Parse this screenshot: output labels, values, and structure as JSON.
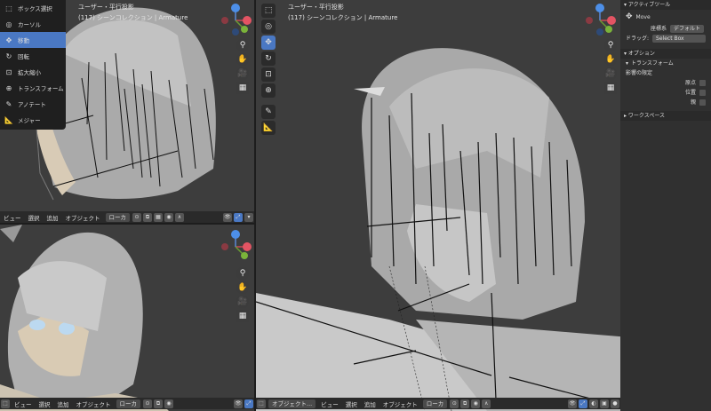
{
  "colors": {
    "viewport_bg": "#3d3d3d",
    "accent": "#4a78c3",
    "panel": "#303030",
    "dark": "#1f1f1f"
  },
  "top_left": {
    "menu": [
      {
        "label": "ボックス選択",
        "icon": "select-box-icon",
        "active": false
      },
      {
        "label": "カーソル",
        "icon": "cursor-icon",
        "active": false
      },
      {
        "label": "移動",
        "icon": "move-icon",
        "active": true
      },
      {
        "label": "回転",
        "icon": "rotate-icon",
        "active": false
      },
      {
        "label": "拡大縮小",
        "icon": "scale-icon",
        "active": false
      },
      {
        "label": "トランスフォーム",
        "icon": "transform-icon",
        "active": false
      },
      {
        "label": "アノテート",
        "icon": "annotate-icon",
        "active": false
      },
      {
        "label": "メジャー",
        "icon": "measure-icon",
        "active": false
      }
    ],
    "header": {
      "view": "ビュー",
      "select": "選択",
      "add": "追加",
      "object": "オブジェクト",
      "orientation": "ローカ"
    }
  },
  "bottom_left": {
    "header": {
      "view": "ビュー",
      "select": "選択",
      "add": "追加",
      "object": "オブジェクト",
      "orientation": "ローカ"
    }
  },
  "main": {
    "hud_line1": "ユーザー・平行投影",
    "hud_line2": "(117) シーンコレクション | Armature",
    "header": {
      "mode": "オブジェクト...",
      "view": "ビュー",
      "select": "選択",
      "add": "追加",
      "object": "オブジェクト",
      "orientation": "ローカ"
    }
  },
  "top_left_hud": {
    "line1": "ユーザー・平行投影",
    "line2": "(117) シーンコレクション | Armature"
  },
  "gizmo": {
    "x": "X",
    "y": "Y",
    "z": "Z"
  },
  "props": {
    "active_tool": "アクティブツール",
    "move": "Move",
    "coord_label": "座標系",
    "coord_value": "デフォルト",
    "drag_label": "ドラッグ:",
    "drag_value": "Select Box",
    "options": "オプション",
    "transform": "トランスフォーム",
    "affect": "影響の限定",
    "origin": "原点",
    "location": "位置",
    "parent": "親",
    "workspace": "ワークスペース"
  }
}
